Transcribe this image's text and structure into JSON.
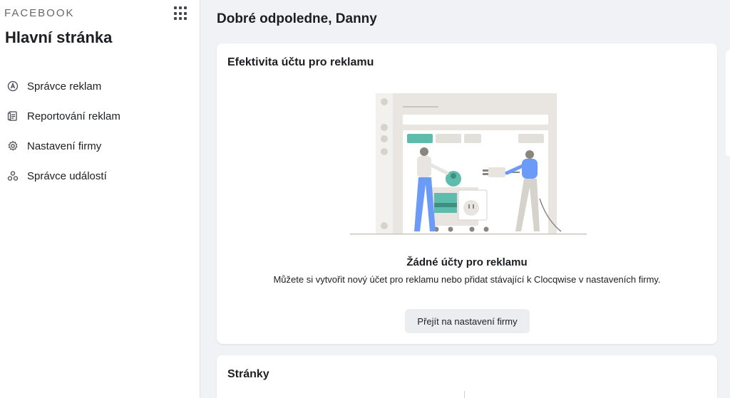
{
  "sidebar": {
    "brand": "FACEBOOK",
    "title": "Hlavní stránka",
    "items": [
      {
        "label": "Správce reklam",
        "icon": "ads-manager-icon"
      },
      {
        "label": "Reportování reklam",
        "icon": "ads-reporting-icon"
      },
      {
        "label": "Nastavení firmy",
        "icon": "gear-icon"
      },
      {
        "label": "Správce událostí",
        "icon": "events-manager-icon"
      }
    ]
  },
  "main": {
    "greeting": "Dobré odpoledne, Danny",
    "ad_card": {
      "title": "Efektivita účtu pro reklamu",
      "empty_title": "Žádné účty pro reklamu",
      "empty_description": "Můžete si vytvořit nový účet pro reklamu nebo přidat stávající k Clocqwise v nastaveních firmy.",
      "button_label": "Přejít na nastavení firmy"
    },
    "pages_card": {
      "title": "Stránky"
    }
  },
  "colors": {
    "accent_teal": "#5dbcab",
    "figure_blue": "#6b9bf7",
    "illustration_gray": "#d6d2cc",
    "background": "#f0f2f5"
  }
}
